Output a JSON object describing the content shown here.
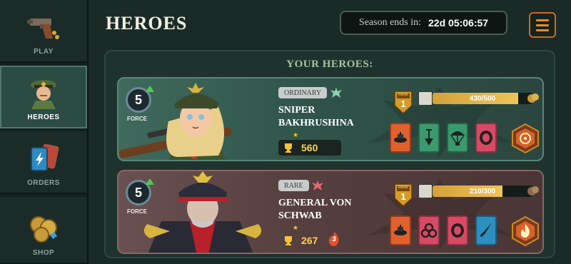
{
  "nav": {
    "items": [
      {
        "label": "PLAY",
        "icon": "pistol-icon",
        "active": false
      },
      {
        "label": "HEROES",
        "icon": "officer-icon",
        "active": true
      },
      {
        "label": "ORDERS",
        "icon": "cards-icon",
        "active": false
      },
      {
        "label": "SHOP",
        "icon": "coins-icon",
        "active": false
      }
    ]
  },
  "header": {
    "title": "HEROES",
    "season_label": "Season ends in:",
    "season_value": "22d 05:06:57",
    "menu_icon": "hamburger-icon"
  },
  "panel": {
    "heading": "YOUR HEROES:",
    "heroes": [
      {
        "force": "5",
        "force_label": "FORCE",
        "rarity": "ORDINARY",
        "name_line1": "SNIPER",
        "name_line2": "BAKHRUSHINA",
        "power": "560",
        "rank_label": "RANK",
        "rank": "1",
        "xp_text": "430/500",
        "xp_fraction": 0.86,
        "skills": [
          "mine-icon",
          "shovel-icon",
          "parachute-icon",
          "ration-icon"
        ],
        "special": "crosshair-icon"
      },
      {
        "force": "5",
        "force_label": "FORCE",
        "rarity": "RARE",
        "name_line1": "GENERAL VON",
        "name_line2": "SCHWAB",
        "power": "267",
        "fire_count": "3",
        "rank_label": "RANK",
        "rank": "1",
        "xp_text": "210/300",
        "xp_fraction": 0.7,
        "skills": [
          "mine-icon",
          "biohazard-icon",
          "ration-icon",
          "knife-icon"
        ],
        "special": "flame-icon"
      }
    ]
  },
  "colors": {
    "accent": "#e78b2a",
    "panel": "#1f332e",
    "card_green": "#3f6a5c",
    "card_red": "#6a5151",
    "power": "#ffd24a"
  }
}
